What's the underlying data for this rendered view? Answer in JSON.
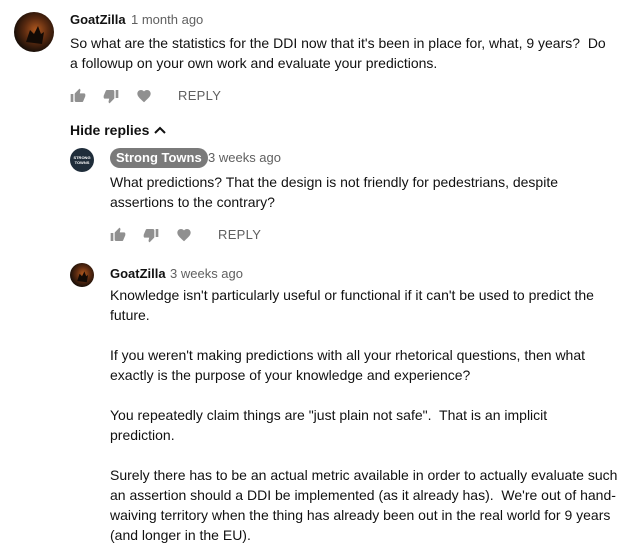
{
  "comments": [
    {
      "author": "GoatZilla",
      "time": "1 month ago",
      "text": "So what are the statistics for the DDI now that it's been in place for, what, 9 years?  Do a followup on your own work and evaluate your predictions.",
      "reply_label": "REPLY",
      "avatar_icon": "goatzilla-avatar"
    }
  ],
  "hide_replies_label": "Hide replies",
  "replies": [
    {
      "author": "Strong Towns",
      "logo_text": "STRONG TOWNS",
      "time": "3 weeks ago",
      "text": "What predictions? That the design is not friendly for pedestrians, despite assertions to the contrary?",
      "reply_label": "REPLY"
    },
    {
      "author": "GoatZilla",
      "time": "3 weeks ago",
      "paragraphs": [
        "Knowledge isn't particularly useful or functional if it can't be used to predict the future.",
        "If you weren't making predictions with all your rhetorical questions, then what exactly is the purpose of your knowledge and experience?",
        "You repeatedly claim things are \"just plain not safe\".  That is an implicit prediction.",
        "Surely there has to be an actual metric available in order to actually evaluate such an assertion should a DDI be implemented (as it already has).  We're out of hand-waiving territory when the thing has already been out in the real world for 9 years (and longer in the EU)."
      ]
    }
  ],
  "colors": {
    "badge_bg": "#7a7a7a",
    "secondary_text": "#606060",
    "icon": "#909090"
  }
}
